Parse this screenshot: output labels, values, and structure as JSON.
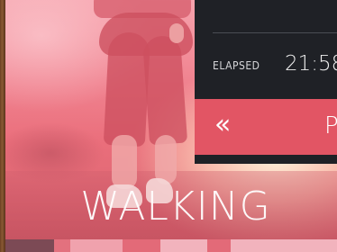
{
  "hero": {
    "title": "WALKING"
  },
  "panel": {
    "elapsed_label": "ELAPSED",
    "elapsed_value": "21:58",
    "rewind_label": "«",
    "next_label": "P"
  },
  "colors": {
    "accent": "#e25564",
    "panel_bg": "#1f2126",
    "text": "#ffffff"
  },
  "strip": [
    {
      "name": "swatch-1",
      "color": "#7c4a55"
    },
    {
      "name": "swatch-2",
      "color": "#e3717e"
    },
    {
      "name": "swatch-3",
      "color": "#f0a2ad"
    },
    {
      "name": "swatch-4",
      "color": "#e36a78"
    },
    {
      "name": "swatch-5",
      "color": "#f2b3bd"
    },
    {
      "name": "swatch-6",
      "color": "#e36a78"
    },
    {
      "name": "swatch-7",
      "color": "#f2b3bd"
    }
  ]
}
